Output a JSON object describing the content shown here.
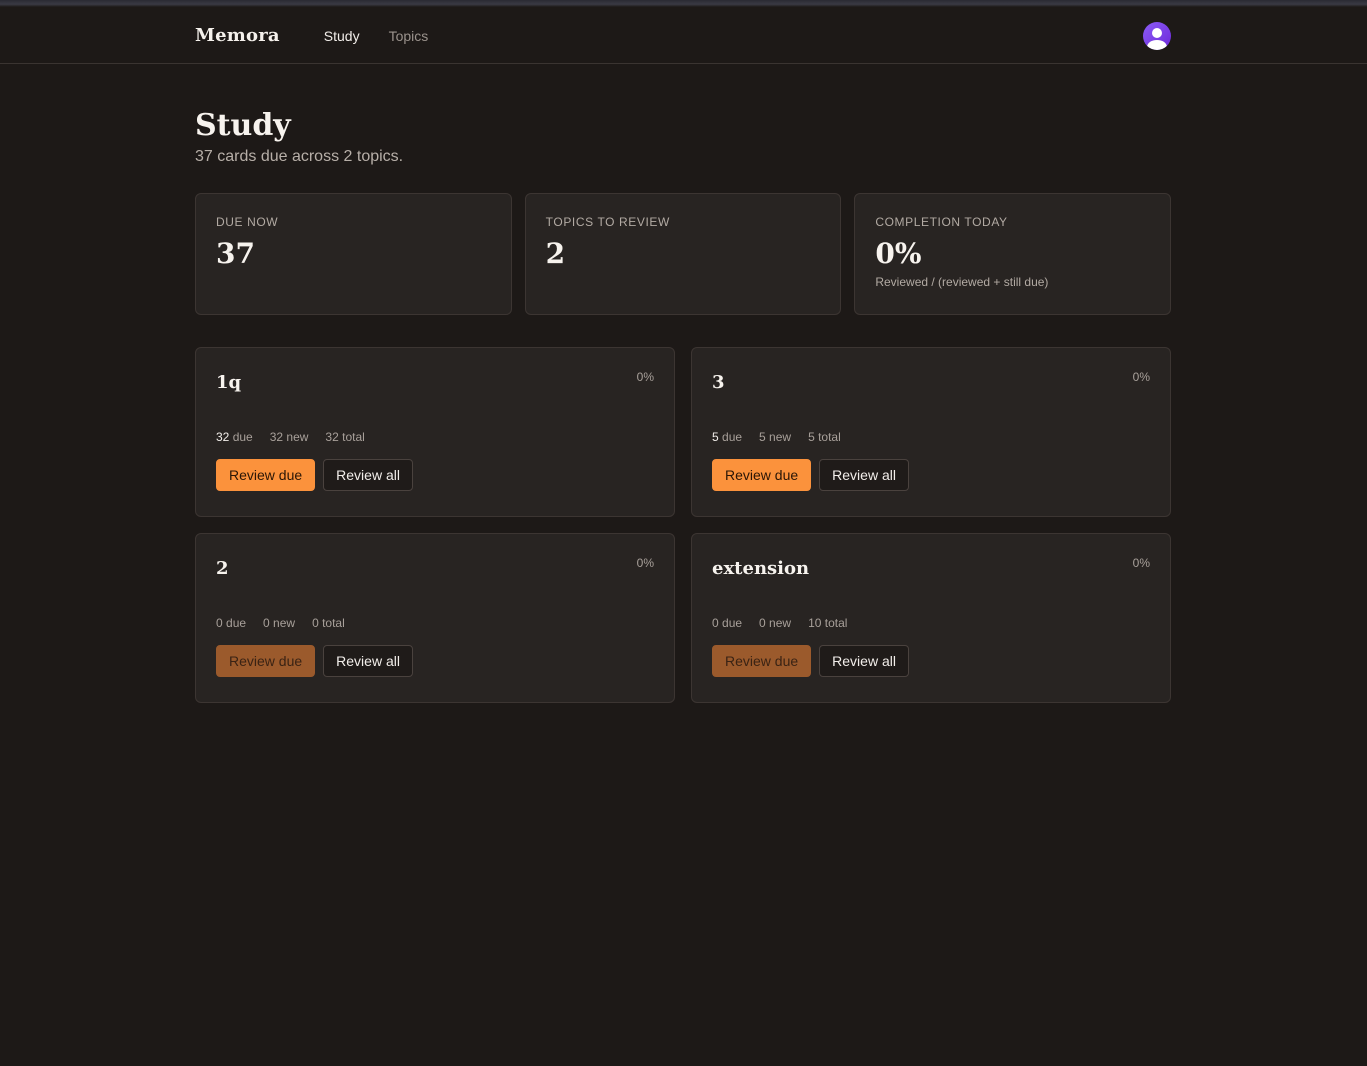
{
  "nav": {
    "brand": "Memora",
    "links": [
      {
        "label": "Study",
        "active": true
      },
      {
        "label": "Topics",
        "active": false
      }
    ]
  },
  "page": {
    "title": "Study",
    "subtitle": "37 cards due across 2 topics."
  },
  "stats": [
    {
      "label": "DUE NOW",
      "value": "37",
      "note": ""
    },
    {
      "label": "TOPICS TO REVIEW",
      "value": "2",
      "note": ""
    },
    {
      "label": "COMPLETION TODAY",
      "value": "0%",
      "note": "Reviewed / (reviewed + still due)"
    }
  ],
  "topics": [
    {
      "name": "1q",
      "pct": "0%",
      "due": "32",
      "due_label": " due",
      "new": "32 new",
      "total": "32 total",
      "review_due": "Review due",
      "review_all": "Review all",
      "has_due": true
    },
    {
      "name": "3",
      "pct": "0%",
      "due": "5",
      "due_label": " due",
      "new": "5 new",
      "total": "5 total",
      "review_due": "Review due",
      "review_all": "Review all",
      "has_due": true
    },
    {
      "name": "2",
      "pct": "0%",
      "due": "0",
      "due_label": " due",
      "new": "0 new",
      "total": "0 total",
      "review_due": "Review due",
      "review_all": "Review all",
      "has_due": false
    },
    {
      "name": "extension",
      "pct": "0%",
      "due": "0",
      "due_label": " due",
      "new": "0 new",
      "total": "10 total",
      "review_due": "Review due",
      "review_all": "Review all",
      "has_due": false
    }
  ],
  "colors": {
    "accent": "#fb923c",
    "accent_disabled": "#9b5a2c",
    "background": "#1d1917",
    "card": "#282422",
    "avatar": "#7c3aed"
  },
  "icons": {
    "avatar": "user-avatar-icon"
  }
}
